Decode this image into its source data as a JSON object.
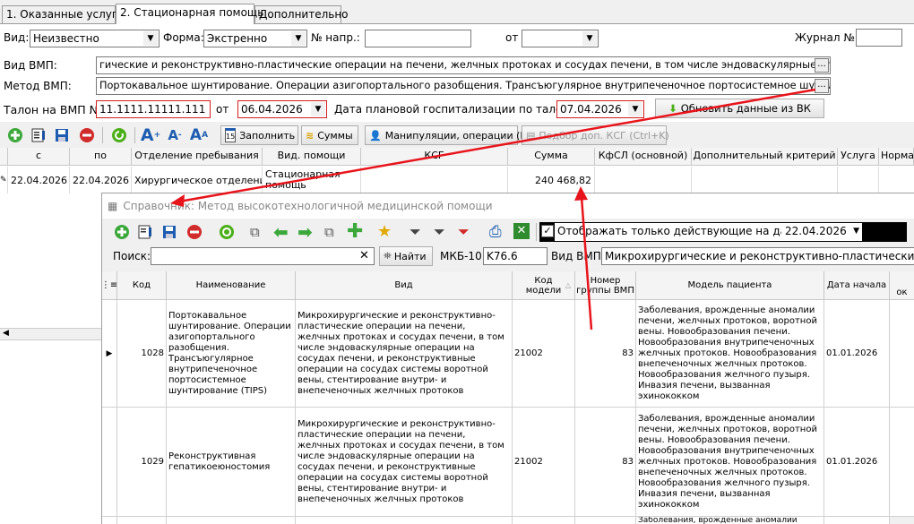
{
  "tabs": [
    "1. Оказанные услуги",
    "2. Стационарная помощь",
    "Дополнительно"
  ],
  "form": {
    "vid_label": "Вид:",
    "vid_value": "Неизвестно",
    "forma_label": "Форма:",
    "forma_value": "Экстренно",
    "nom_napr_label": "№ напр.:",
    "nom_napr_value": "",
    "ot_label": "от",
    "ot_value": "",
    "journal_label": "Журнал №",
    "journal_value": "",
    "vid_vmp_label": "Вид ВМП:",
    "vid_vmp_value": "гические и реконструктивно-пластические операции на печени, желчных протоках и сосудах печени, в том числе эндоваскулярные опе",
    "metod_vmp_label": "Метод ВМП:",
    "metod_vmp_value": "Портокавальное шунтирование. Операции азигопортального разобщения. Трансъюгулярное внутрипеченочное портосистемное шунтиро",
    "talon_label": "Талон на ВМП №",
    "talon_value": "11.1111.11111.111",
    "talon_ot_label": "от",
    "talon_date": "06.04.2026",
    "plan_date_label": "Дата плановой госпитализации по талону",
    "plan_date": "07.04.2026",
    "refresh_button": "Обновить данные из ВК",
    "ellipsis": "..."
  },
  "toolbar": {
    "fill_button": "Заполнить",
    "sums_button": "Суммы",
    "manip_button": "Манипуляции, операции (F5)",
    "ksg_button": "Подбор доп. КСГ (Ctrl+K)",
    "calendar_day": "15"
  },
  "grid": {
    "headers": [
      "с",
      "по",
      "Отделение пребывания",
      "Вид. помощи",
      "КСГ",
      "Сумма",
      "КфСЛ (основной)",
      "Дополнительный критерий",
      "Услуга",
      "Норма"
    ],
    "row": {
      "from": "22.04.2026",
      "to": "22.04.2026",
      "dept": "Хирургическое отделение",
      "help_line1": "Стационарная",
      "help_line2": "помощь",
      "ksg": "",
      "sum": "240 468,82",
      "kfsl": "",
      "dop": "",
      "usluga": ""
    }
  },
  "dialog": {
    "title": "Справочник: Метод высокотехнологичной медицинской помощи",
    "show_active_label": "Отображать только действующие на дату:",
    "show_active_date": "22.04.2026",
    "search_label": "Поиск:",
    "search_value": "",
    "find_button": "Найти",
    "mkb_label": "МКБ-10:",
    "mkb_value": "K76.6",
    "vid_vmp_label": "Вид ВМП:",
    "vid_vmp_value": "Микрохирургические и реконструктивно-пластические опер",
    "headers": {
      "code": "Код",
      "name": "Наименование",
      "vid": "Вид",
      "model_code_1": "Код",
      "model_code_2": "модели",
      "group_1": "Номер",
      "group_2": "группы ВМП",
      "patient": "Модель пациента",
      "start": "Дата начала",
      "end": "ок"
    },
    "rows": [
      {
        "code": "1028",
        "name": "Портокавальное шунтирование. Операции азигопортального разобщения. Трансъюгулярное внутрипеченочное портосистемное шунтирование (TIPS)",
        "vid": "Микрохирургические и реконструктивно-пластические операции на печени, желчных протоках и сосудах печени, в том числе эндоваскулярные операции на сосудах печени, и реконструктивные операции на сосудах системы воротной вены, стентирование внутри- и внепеченочных желчных протоков",
        "model_code": "21002",
        "group": "83",
        "patient": "Заболевания, врожденные аномалии печени, желчных протоков, воротной вены. Новообразования печени. Новообразования внутрипеченочных желчных протоков. Новообразования внепеченочных желчных протоков. Новообразования желчного пузыря. Инвазия печени, вызванная эхинококком",
        "start": "01.01.2026"
      },
      {
        "code": "1029",
        "name": "Реконструктивная гепатикоеюностомия",
        "vid": "Микрохирургические и реконструктивно-пластические операции на печени, желчных протоках и сосудах печени, в том числе эндоваскулярные операции на сосудах печени, и реконструктивные операции на сосудах системы воротной вены, стентирование внутри- и внепеченочных желчных протоков",
        "model_code": "21002",
        "group": "83",
        "patient": "Заболевания, врожденные аномалии печени, желчных протоков, воротной вены. Новообразования печени. Новообразования внутрипеченочных желчных протоков. Новообразования внепеченочных желчных протоков. Новообразования желчного пузыря. Инвазия печени, вызванная эхинококком",
        "start": "01.01.2026"
      }
    ],
    "partial_row": "Заболевания, врожденные аномалии"
  },
  "colors": {
    "accent_red": "#d21e1e",
    "annotation_red": "#e8141b"
  }
}
